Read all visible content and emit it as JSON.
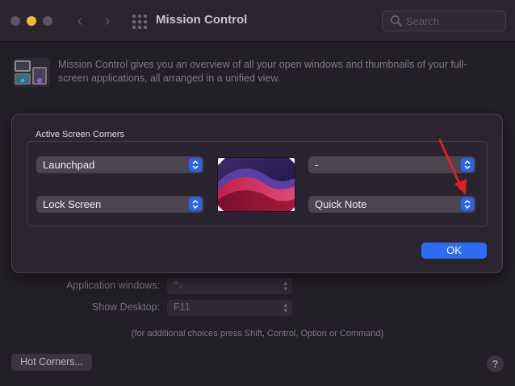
{
  "window": {
    "title": "Mission Control",
    "search_placeholder": "Search"
  },
  "header": {
    "icon": "mission-control-app-icon",
    "description": "Mission Control gives you an overview of all your open windows and thumbnails of your full-screen applications, all arranged in a unified view."
  },
  "settings": {
    "application_windows_label": "Application windows:",
    "application_windows_value": "^↓",
    "show_desktop_label": "Show Desktop:",
    "show_desktop_value": "F11",
    "footnote": "(for additional choices press Shift, Control, Option or Command)",
    "hot_corners_button": "Hot Corners...",
    "help_label": "?"
  },
  "sheet": {
    "title": "Active Screen Corners",
    "top_left": "Launchpad",
    "top_right": "-",
    "bottom_left": "Lock Screen",
    "bottom_right": "Quick Note",
    "ok_label": "OK"
  },
  "colors": {
    "accent": "#2d6df4",
    "stepper": "#2a64ee",
    "minimize_light": "#f2b82e",
    "annotation_arrow": "#e02020"
  }
}
